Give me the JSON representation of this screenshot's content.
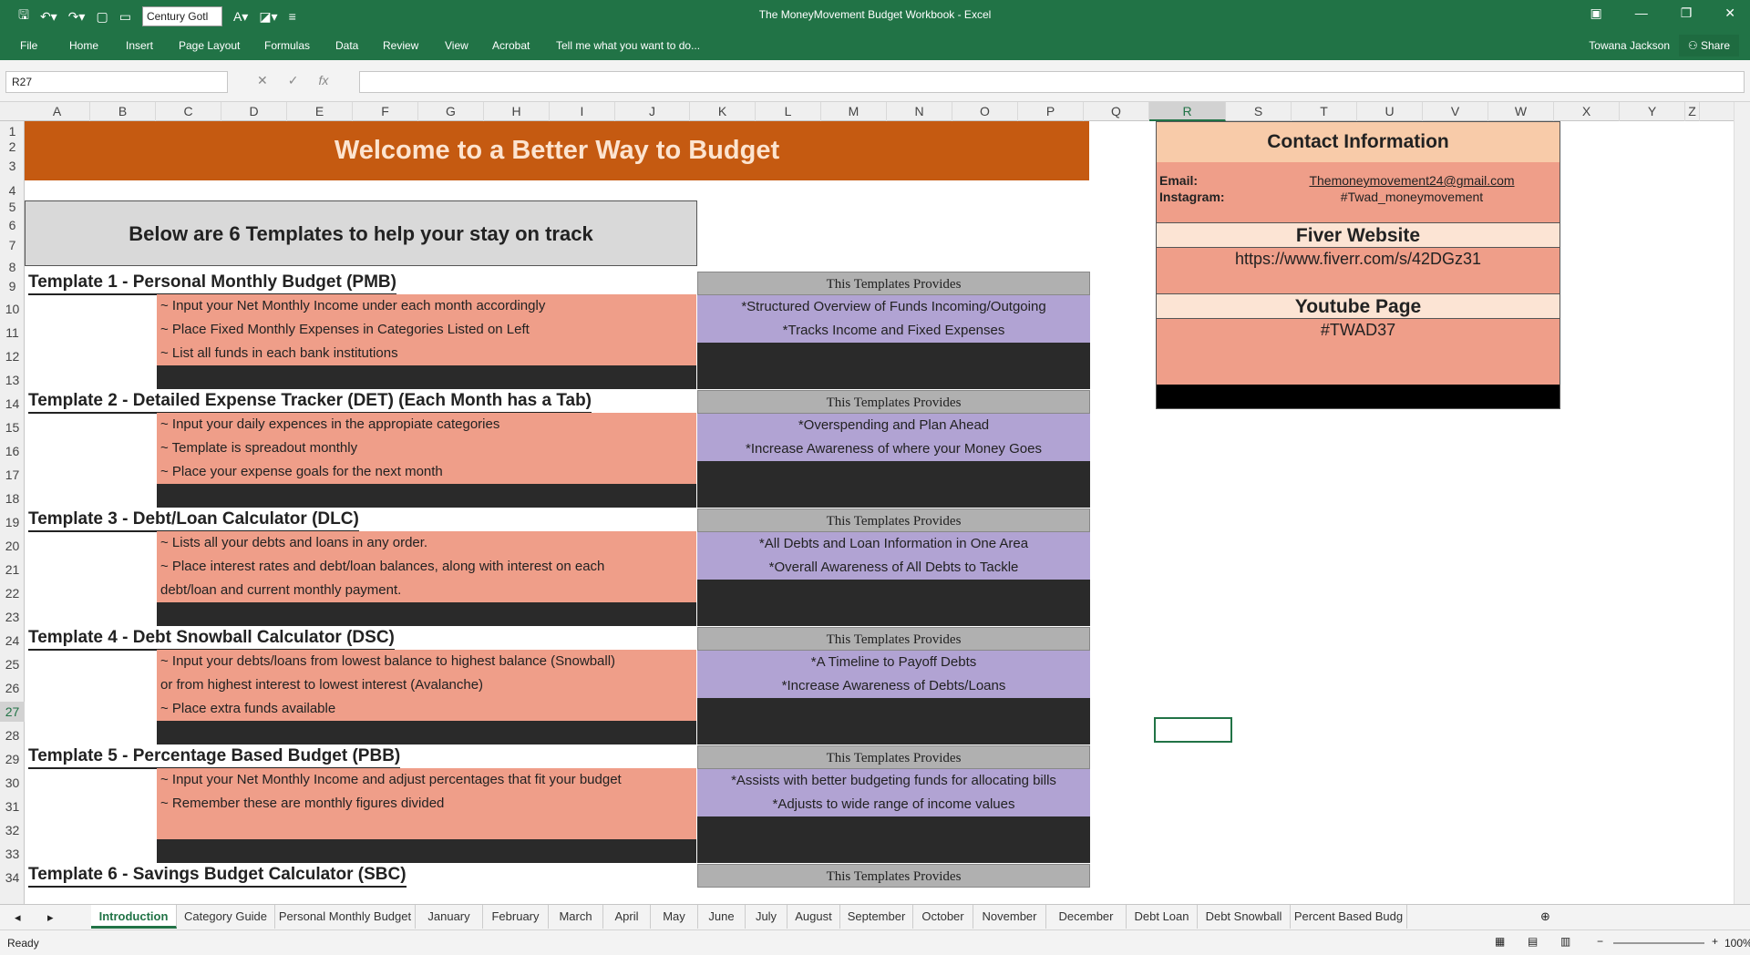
{
  "titlebar": {
    "title": "The MoneyMovement Budget Workbook - Excel",
    "font_name": "Century Gotl"
  },
  "menu": [
    "File",
    "Home",
    "Insert",
    "Page Layout",
    "Formulas",
    "Data",
    "Review",
    "View",
    "Acrobat",
    "Tell me what you want to do..."
  ],
  "user": {
    "name": "Towana Jackson",
    "share": "Share"
  },
  "formula": {
    "name_box": "R27",
    "content": ""
  },
  "columns": [
    "A",
    "B",
    "C",
    "D",
    "E",
    "F",
    "G",
    "H",
    "I",
    "J",
    "K",
    "L",
    "M",
    "N",
    "O",
    "P",
    "Q",
    "R",
    "S",
    "T",
    "U",
    "V",
    "W",
    "X",
    "Y",
    "Z"
  ],
  "selected_column": "R",
  "rows": [
    "1",
    "2",
    "3",
    "4",
    "5",
    "6",
    "7",
    "8",
    "9",
    "10",
    "11",
    "12",
    "13",
    "14",
    "15",
    "16",
    "17",
    "18",
    "19",
    "20",
    "21",
    "22",
    "23",
    "24",
    "25",
    "26",
    "27",
    "28",
    "29",
    "30",
    "31",
    "32",
    "33",
    "34"
  ],
  "selected_row": "27",
  "sheet": {
    "banner": "Welcome to a Better Way to Budget",
    "subtitle": "Below are 6 Templates to help your stay on track",
    "provides_label": "This Templates Provides",
    "templates": [
      {
        "title": "Template 1 - Personal Monthly Budget (PMB)",
        "steps": [
          "~ Input your Net Monthly Income under each month accordingly",
          "~ Place Fixed Monthly Expenses in Categories Listed on Left",
          "~ List all funds in each bank institutions"
        ],
        "provides": [
          "*Structured Overview of Funds Incoming/Outgoing",
          "*Tracks Income and Fixed Expenses"
        ]
      },
      {
        "title": "Template 2 - Detailed Expense Tracker (DET) (Each Month has a Tab)",
        "steps": [
          "~ Input your daily expences in the appropiate categories",
          "~ Template is spreadout monthly",
          "~ Place your expense goals for the next month"
        ],
        "provides": [
          "*Overspending and Plan Ahead",
          "*Increase Awareness of where your Money Goes"
        ]
      },
      {
        "title": "Template 3 - Debt/Loan Calculator (DLC)",
        "steps": [
          "~ Lists all your debts and loans in any order.",
          "~ Place interest rates and debt/loan balances, along with interest on each",
          "debt/loan and current monthly payment."
        ],
        "provides": [
          "*All Debts and Loan Information in One Area",
          "*Overall Awareness of All Debts to Tackle"
        ]
      },
      {
        "title": "Template 4 - Debt Snowball Calculator (DSC)",
        "steps": [
          "~ Input your debts/loans from lowest balance to highest balance (Snowball)",
          "or from highest interest to lowest interest (Avalanche)",
          "~ Place extra funds available"
        ],
        "provides": [
          "*A Timeline to Payoff Debts",
          "*Increase Awareness of Debts/Loans"
        ]
      },
      {
        "title": "Template 5 - Percentage Based Budget (PBB)",
        "steps": [
          "~ Input your Net Monthly Income and adjust percentages that fit your budget",
          "~ Remember these are monthly figures divided",
          ""
        ],
        "provides": [
          "*Assists with better budgeting funds for allocating bills",
          "*Adjusts to wide range of income values"
        ]
      },
      {
        "title": "Template 6 - Savings Budget Calculator (SBC)"
      }
    ],
    "contact": {
      "heading": "Contact Information",
      "email_label": "Email:",
      "email": "Themoneymovement24@gmail.com",
      "instagram_label": "Instagram:",
      "instagram": "#Twad_moneymovement",
      "fiverr_heading": "Fiver Website",
      "fiverr_url": "https://www.fiverr.com/s/42DGz31",
      "youtube_heading": "Youtube Page",
      "youtube": "#TWAD37"
    }
  },
  "tabs": [
    "Introduction",
    "Category Guide",
    "Personal Monthly Budget",
    "January",
    "February",
    "March",
    "April",
    "May",
    "June",
    "July",
    "August",
    "September",
    "October",
    "November",
    "December",
    "Debt Loan",
    "Debt Snowball",
    "Percent Based Budg"
  ],
  "active_tab": "Introduction",
  "status": {
    "ready": "Ready",
    "zoom": "100%"
  },
  "colors": {
    "excel_green": "#217346",
    "banner": "#c55a11",
    "salmon": "#ef9e89",
    "purple": "#b1a3d3",
    "peach": "#f8cba9"
  }
}
